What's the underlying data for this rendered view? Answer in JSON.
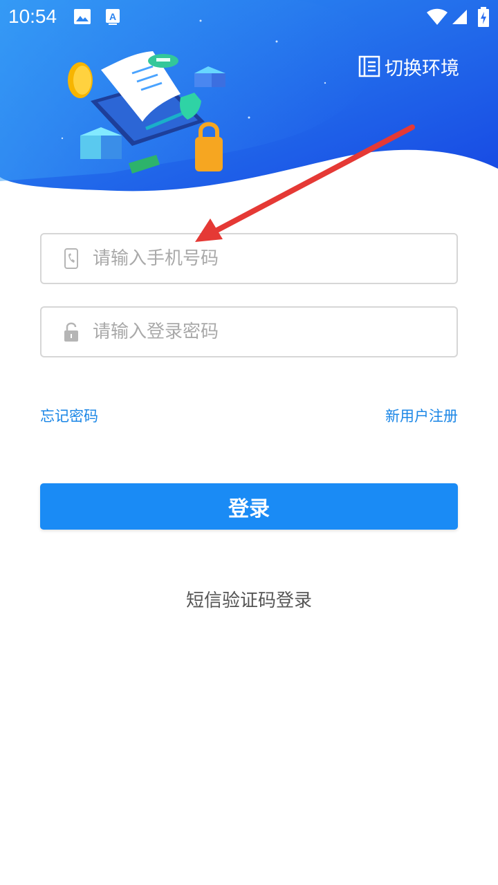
{
  "status_bar": {
    "time": "10:54",
    "left_icons": [
      "gallery-icon",
      "text-app-icon"
    ],
    "right_icons": [
      "wifi-icon",
      "signal-icon",
      "battery-charging-icon"
    ]
  },
  "header": {
    "switch_env_label": "切换环境",
    "switch_env_icon": "document-list-icon",
    "gradient_colors": [
      "#2b8ef2",
      "#1a4fe6"
    ]
  },
  "form": {
    "phone": {
      "placeholder": "请输入手机号码",
      "value": "",
      "icon": "phone-icon"
    },
    "password": {
      "placeholder": "请输入登录密码",
      "value": "",
      "icon": "lock-icon"
    }
  },
  "links": {
    "forgot_password": "忘记密码",
    "register": "新用户注册"
  },
  "login_button_label": "登录",
  "sms_login_label": "短信验证码登录",
  "colors": {
    "accent": "#1a8bf5",
    "link": "#1a86e6",
    "annotation_arrow": "#e53935"
  }
}
